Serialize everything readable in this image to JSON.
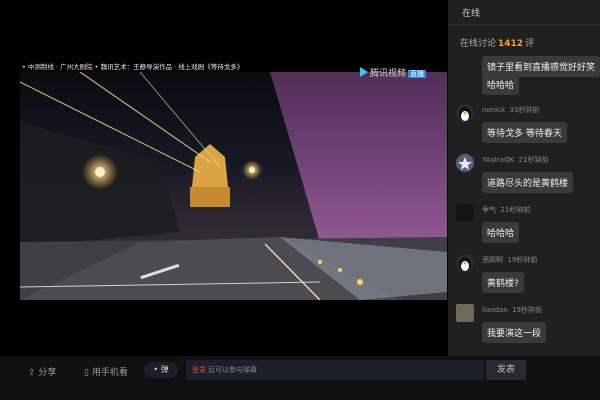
{
  "video": {
    "caption": "• 中测制线 · 广州大剧院 • 魏讯艺术：王静导演作品 · 线上戏剧《等待戈多》",
    "watermark": "腾讯视频",
    "watermark_tag": "直播"
  },
  "bottom": {
    "share_label": "分享",
    "phone_label": "用手机看",
    "danmaku_label": "弹",
    "login_label": "登录",
    "input_placeholder": "后可以参与弹幕",
    "send_label": "发表"
  },
  "chat": {
    "tabs": [
      "在线",
      ""
    ],
    "count_prefix": "在线讨论",
    "count": "1412",
    "count_suffix": "评",
    "messages": [
      {
        "name": "",
        "time": "",
        "text": "镜子里看到直播感觉好好笑",
        "avatar": "none"
      },
      {
        "name": "",
        "time": "",
        "text": "哈哈哈",
        "avatar": "none"
      },
      {
        "name": "nonick",
        "time": "33秒钟前",
        "text": "等待戈多 等待春天",
        "avatar": "penguin"
      },
      {
        "name": "YAstraQK",
        "time": "21秒钟前",
        "text": "道路尽头的是黄鹤楼",
        "avatar": "star"
      },
      {
        "name": "争气",
        "time": "21秒钟前",
        "text": "哈哈哈",
        "avatar": "dark"
      },
      {
        "name": "酒窝啊",
        "time": "19秒钟前",
        "text": "黄鹤楼?",
        "avatar": "penguin"
      },
      {
        "name": "liaodan",
        "time": "19秒钟前",
        "text": "我要演这一段",
        "avatar": "photo"
      }
    ]
  }
}
